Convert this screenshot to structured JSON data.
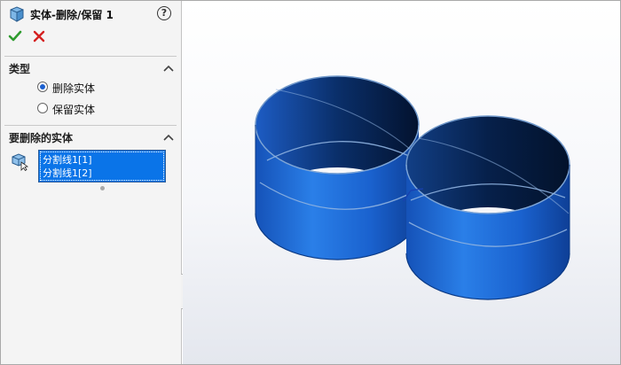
{
  "property_manager": {
    "title": "实体-删除/保留 1",
    "help_symbol": "?",
    "sections": {
      "type": {
        "title": "类型",
        "options": [
          {
            "label": "删除实体",
            "selected": true
          },
          {
            "label": "保留实体",
            "selected": false
          }
        ]
      },
      "bodies_to_delete": {
        "title": "要删除的实体",
        "items": [
          "分割线1[1]",
          "分割线1[2]"
        ]
      }
    }
  },
  "colors": {
    "accent": "#1b5fcf",
    "selection": "#0a74e8",
    "ok": "#2e9b2e",
    "cancel": "#d42020",
    "body_blue": "#1e6fe0"
  },
  "icons": {
    "title": "delete-body-icon",
    "help": "help-icon",
    "ok": "checkmark-icon",
    "cancel": "close-icon",
    "collapse": "chevron-up-icon",
    "selection": "solid-body-selection-icon"
  }
}
